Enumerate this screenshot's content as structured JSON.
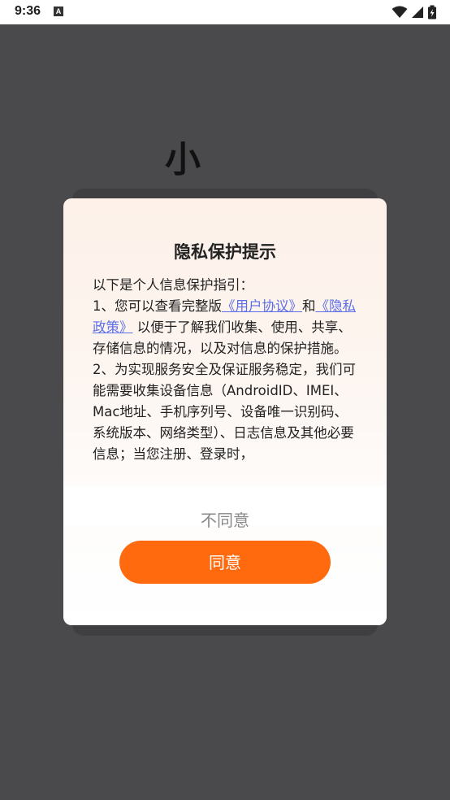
{
  "status_bar": {
    "time": "9:36",
    "notification_glyph": "A",
    "icons": [
      "wifi-icon",
      "signal-icon",
      "battery-charging-icon"
    ]
  },
  "background": {
    "app_title": "小"
  },
  "dialog": {
    "title": "隐私保护提示",
    "intro": "以下是个人信息保护指引：",
    "item1_prefix": "1、您可以查看完整版",
    "user_agreement_link": "《用户协议》",
    "item1_and": "和",
    "privacy_policy_link": "《隐私政策》",
    "item1_suffix": "以便于了解我们收集、使用、共享、存储信息的情况，以及对信息的保护措施。",
    "item2": "2、为实现服务安全及保证服务稳定，我们可能需要收集设备信息（AndroidID、IMEI、Mac地址、手机序列号、设备唯一识别码、系统版本、网络类型）、日志信息及其他必要信息；当您注册、登录时，",
    "disagree_label": "不同意",
    "agree_label": "同意"
  },
  "colors": {
    "accent": "#ff6a0f",
    "link": "#5b6ee8",
    "backdrop": "#4a4a4d"
  }
}
